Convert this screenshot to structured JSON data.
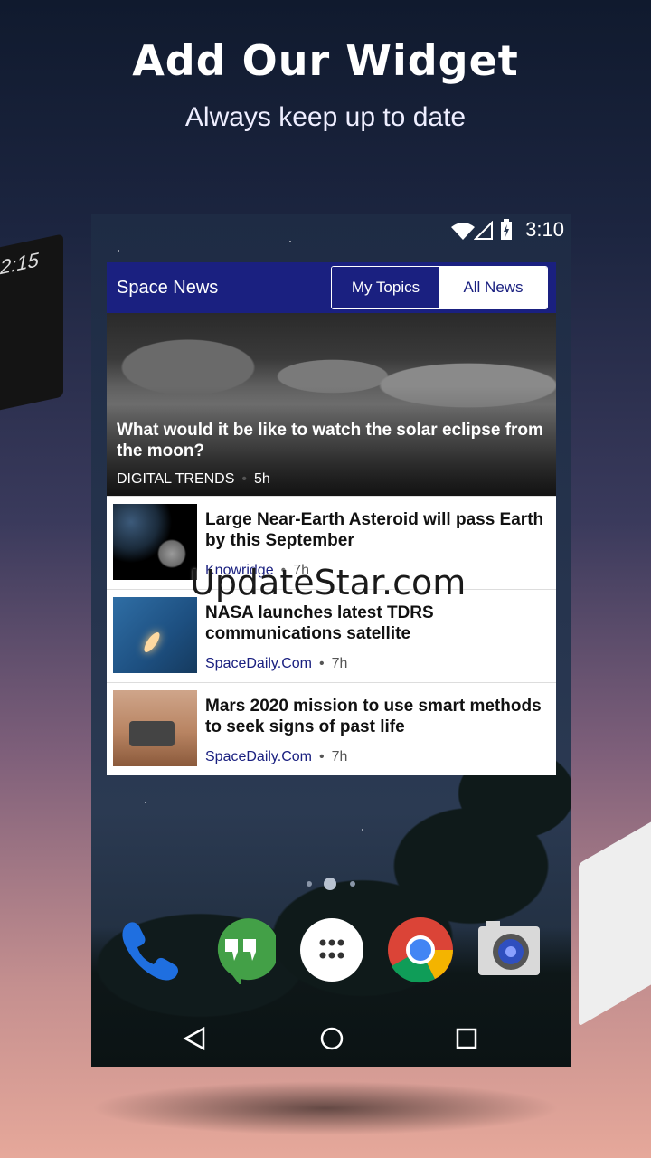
{
  "promo": {
    "headline": "Add Our Widget",
    "subline": "Always keep up to date"
  },
  "side_phone": {
    "clock": "2:15"
  },
  "status_bar": {
    "time": "3:10",
    "icons": [
      "wifi-icon",
      "signal-icon",
      "battery-charging-icon"
    ]
  },
  "widget": {
    "title": "Space News",
    "tabs": [
      {
        "label": "My Topics",
        "active": true
      },
      {
        "label": "All News",
        "active": false
      }
    ],
    "hero": {
      "title": "What would it be like to watch the solar eclipse from the moon?",
      "source": "DIGITAL TRENDS",
      "age": "5h"
    },
    "items": [
      {
        "title": "Large Near-Earth Asteroid will pass Earth by this September",
        "source": "Knowridge",
        "age": "7h"
      },
      {
        "title": "NASA launches latest TDRS communications satellite",
        "source": "SpaceDaily.Com",
        "age": "7h"
      },
      {
        "title": "Mars 2020 mission to use smart methods to seek signs of past life",
        "source": "SpaceDaily.Com",
        "age": "7h"
      }
    ]
  },
  "watermark": "UpdateStar.com",
  "dock": {
    "apps": [
      "phone-icon",
      "hangouts-icon",
      "app-drawer-icon",
      "chrome-icon",
      "camera-icon"
    ]
  },
  "nav": {
    "buttons": [
      "back-icon",
      "home-icon",
      "recents-icon"
    ]
  },
  "colors": {
    "widget_header": "#1a2080",
    "text_dark": "#111111"
  }
}
